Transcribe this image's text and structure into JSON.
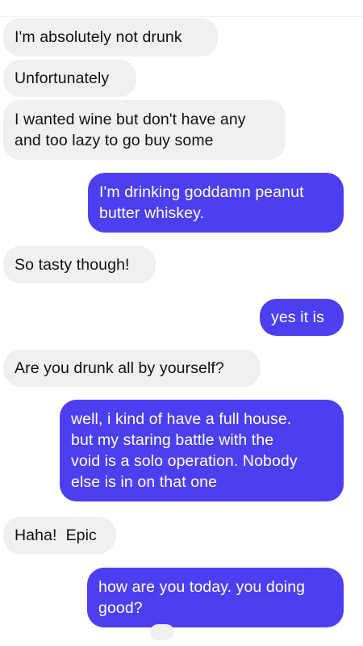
{
  "messages": [
    {
      "side": "incoming",
      "text": "I'm absolutely not drunk"
    },
    {
      "side": "incoming",
      "text": "Unfortunately"
    },
    {
      "side": "incoming",
      "text": "I wanted wine but don't have any\nand too lazy to go buy some"
    },
    {
      "side": "outgoing",
      "text": "I'm drinking goddamn peanut\nbutter whiskey."
    },
    {
      "side": "incoming",
      "text": "So tasty though!"
    },
    {
      "side": "outgoing",
      "text": "yes it is"
    },
    {
      "side": "incoming",
      "text": "Are you drunk all by yourself?"
    },
    {
      "side": "outgoing",
      "text": "well, i kind of have a full house.\nbut my staring battle with the\nvoid is a solo operation. Nobody\nelse is in on that one"
    },
    {
      "side": "incoming",
      "text": "Haha!  Epic"
    },
    {
      "side": "outgoing",
      "text": "how are you today. you doing\ngood?"
    }
  ],
  "colors": {
    "incoming_bubble": "#f1f0f0",
    "incoming_text": "#111111",
    "outgoing_bubble": "#4d3ff0",
    "outgoing_text": "#ffffff",
    "background": "#ffffff"
  }
}
